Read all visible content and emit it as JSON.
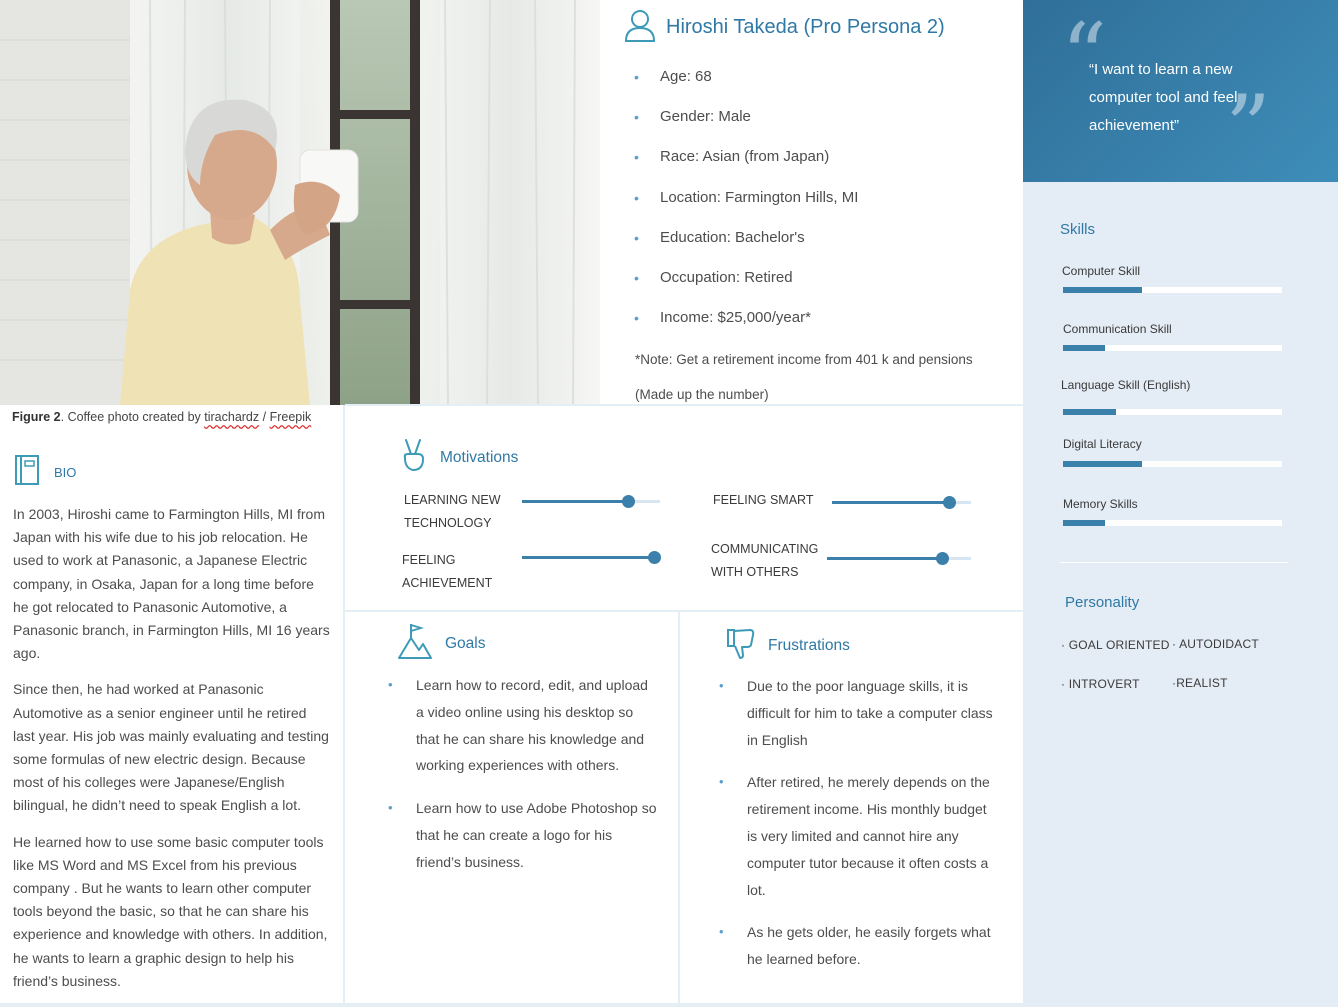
{
  "caption": {
    "figure": "Figure 2",
    "text": ". Coffee photo created by ",
    "author": "tirachardz",
    "sep": " / ",
    "source": "Freepik"
  },
  "persona": {
    "name": "Hiroshi Takeda (Pro Persona 2)",
    "demographics": [
      "Age: 68",
      "Gender: Male",
      "Race: Asian (from Japan)",
      "Location: Farmington Hills, MI",
      "Education: Bachelor's",
      "Occupation: Retired",
      "Income: $25,000/year*"
    ],
    "note": "*Note: Get a retirement income from 401 k and pensions (Made up the number)"
  },
  "quote": {
    "text": "“I want to learn a new computer tool and feel achievement”"
  },
  "skills": {
    "title": "Skills",
    "items": [
      {
        "label": "Computer Skill",
        "level": 0.36
      },
      {
        "label": "Communication Skill",
        "level": 0.19
      },
      {
        "label": "Language Skill (English)",
        "level": 0.24
      },
      {
        "label": "Digital Literacy",
        "level": 0.36
      },
      {
        "label": "Memory Skills",
        "level": 0.19
      }
    ]
  },
  "personality": {
    "title": "Personality",
    "traits": [
      "· GOAL ORIENTED",
      "· AUTODIDACT",
      "· INTROVERT",
      "·REALIST"
    ]
  },
  "bio": {
    "title": "BIO",
    "paragraphs": [
      "In 2003, Hiroshi came to Farmington Hills, MI from Japan with his wife due to his job relocation. He used to work at Panasonic, a Japanese Electric company, in Osaka, Japan for a long time before he got relocated to Panasonic Automotive, a Panasonic branch, in Farmington Hills, MI 16 years ago.",
      "Since then, he had worked at Panasonic Automotive as a senior engineer until he retired last year. His job was mainly evaluating and testing some formulas of new electric design. Because most of his colleges were Japanese/English bilingual, he didn’t need to speak English a lot.",
      "He learned how to use some basic computer tools like MS Word and MS Excel from his previous company . But he wants to learn other computer tools beyond the basic, so that he can share his experience and knowledge with others. In addition, he wants to learn a graphic design to help his friend’s business."
    ]
  },
  "motivations": {
    "title": "Motivations",
    "items": [
      {
        "label_1": "LEARNING NEW",
        "label_2": "TECHNOLOGY",
        "level": 0.77
      },
      {
        "label_1": "FEELING SMART",
        "label_2": "",
        "level": 0.84
      },
      {
        "label_1": "FEELING",
        "label_2": "ACHIEVEMENT",
        "level": 0.95
      },
      {
        "label_1": "COMMUNICATING",
        "label_2": "WITH OTHERS",
        "level": 0.8
      }
    ]
  },
  "goals": {
    "title": "Goals",
    "items": [
      "Learn how to record, edit, and upload a video online using his desktop so that he can share his knowledge and working experiences with others.",
      "Learn how to use Adobe Photoshop so that he can create a logo for his friend’s business."
    ]
  },
  "frustrations": {
    "title": "Frustrations",
    "items": [
      "Due to the poor language skills, it is difficult for him to take a computer class in English",
      "After retired, he merely depends on the retirement income. His monthly budget is very limited and cannot hire any computer tutor because it often costs a lot.",
      "As he gets older, he easily forgets what he learned before."
    ]
  },
  "colors": {
    "accent": "#2f79a6",
    "bar": "#3b7fab",
    "sidebar": "#e4ecf5"
  }
}
